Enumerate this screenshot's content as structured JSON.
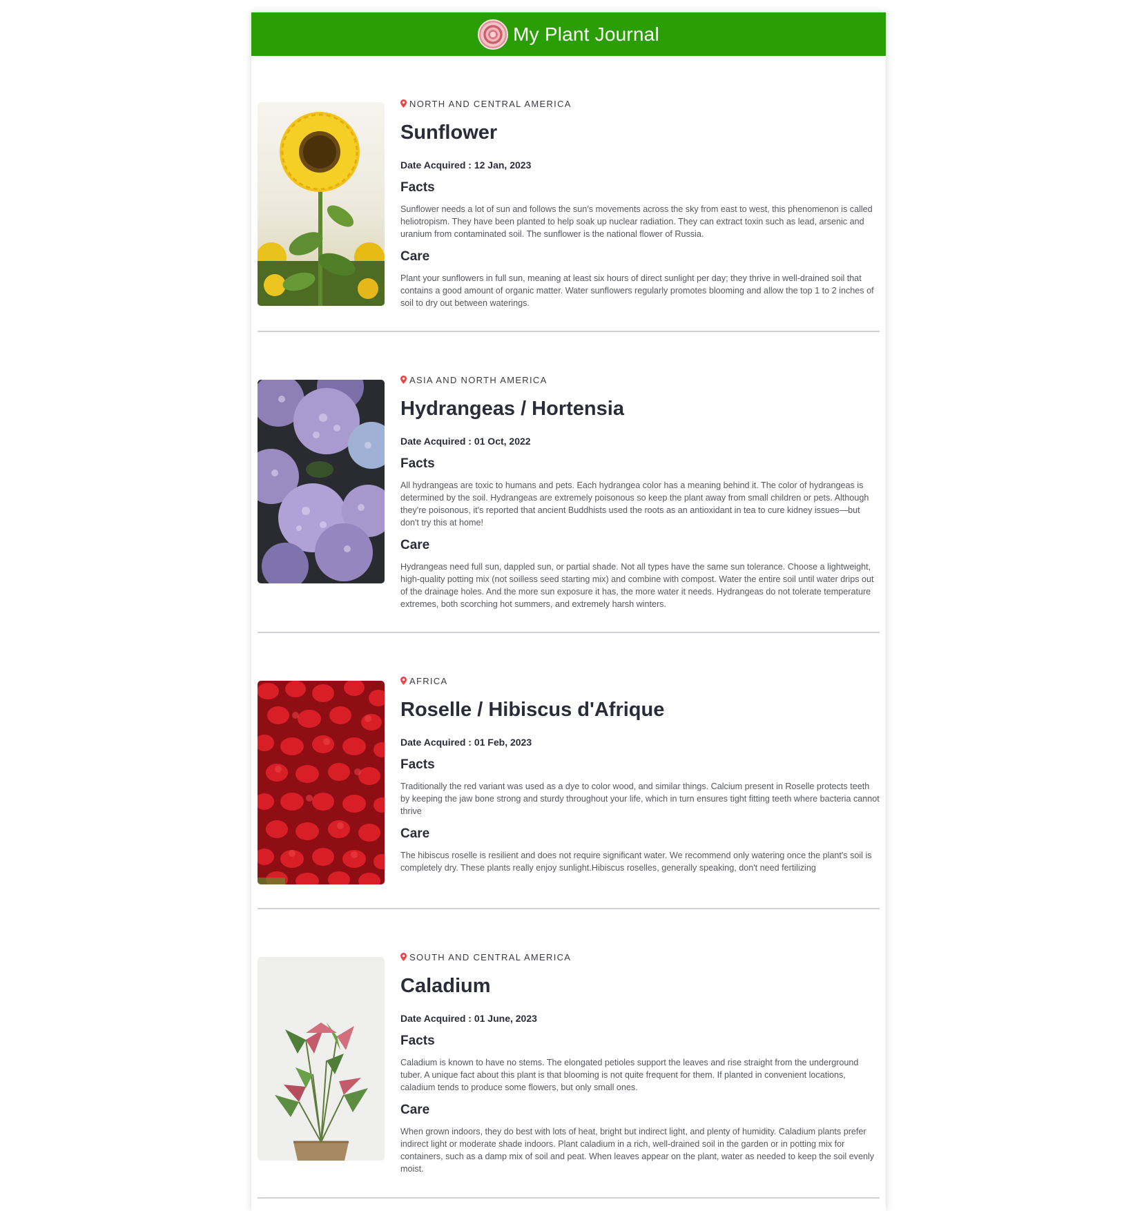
{
  "header": {
    "title": "My Plant Journal",
    "logo_icon": "rose-icon",
    "color": "#2a9e04"
  },
  "entries": [
    {
      "region": "NORTH AND CENTRAL AMERICA",
      "name": "Sunflower",
      "date_label": "Date Acquired :",
      "date": "12 Jan, 2023",
      "facts_heading": "Facts",
      "facts": "Sunflower needs a lot of sun and follows the sun’s movements across the sky from east to west, this phenomenon is called heliotropism. They have been planted to help soak up nuclear radiation. They can extract toxin such as lead, arsenic and uranium from contaminated soil. The sunflower is the national flower of Russia.",
      "care_heading": "Care",
      "care": "Plant your sunflowers in full sun, meaning at least six hours of direct sunlight per day; they thrive in well-drained soil that contains a good amount of organic matter. Water sunflowers regularly promotes blooming and allow the top 1 to 2 inches of soil to dry out between waterings."
    },
    {
      "region": "ASIA AND NORTH AMERICA",
      "name": "Hydrangeas / Hortensia",
      "date_label": "Date Acquired :",
      "date": "01 Oct, 2022",
      "facts_heading": "Facts",
      "facts": "All hydrangeas are toxic to humans and pets. Each hydrangea color has a meaning behind it. The color of hydrangeas is determined by the soil. Hydrangeas are extremely poisonous so keep the plant away from small children or pets. Although they're poisonous, it's reported that ancient Buddhists used the roots as an antioxidant in tea to cure kidney issues—but don't try this at home!",
      "care_heading": "Care",
      "care": "Hydrangeas need full sun, dappled sun, or partial shade. Not all types have the same sun tolerance. Choose a lightweight, high-quality potting mix (not soilless seed starting mix) and combine with compost. Water the entire soil until water drips out of the drainage holes. And the more sun exposure it has, the more water it needs. Hydrangeas do not tolerate temperature extremes, both scorching hot summers, and extremely harsh winters."
    },
    {
      "region": "AFRICA",
      "name": "Roselle / Hibiscus d'Afrique",
      "date_label": "Date Acquired :",
      "date": "01 Feb, 2023",
      "facts_heading": "Facts",
      "facts": "Traditionally the red variant was used as a dye to color wood, and similar things. Calcium present in Roselle protects teeth by keeping the jaw bone strong and sturdy throughout your life, which in turn ensures tight fitting teeth where bacteria cannot thrive",
      "care_heading": "Care",
      "care": "The hibiscus roselle is resilient and does not require significant water. We recommend only watering once the plant's soil is completely dry. These plants really enjoy sunlight.Hibiscus roselles, generally speaking, don't need fertilizing"
    },
    {
      "region": "SOUTH AND CENTRAL AMERICA",
      "name": "Caladium",
      "date_label": "Date Acquired :",
      "date": "01 June, 2023",
      "facts_heading": "Facts",
      "facts": "Caladium is known to have no stems. The elongated petioles support the leaves and rise straight from the underground tuber. A unique fact about this plant is that blooming is not quite frequent for them. If planted in convenient locations, caladium tends to produce some flowers, but only small ones.",
      "care_heading": "Care",
      "care": "When grown indoors, they do best with lots of heat, bright but indirect light, and plenty of humidity. Caladium plants prefer indirect light or moderate shade indoors. Plant caladium in a rich, well-drained soil in the garden or in potting mix for containers, such as a damp mix of soil and peat. When leaves appear on the plant, water as needed to keep the soil evenly moist."
    }
  ]
}
